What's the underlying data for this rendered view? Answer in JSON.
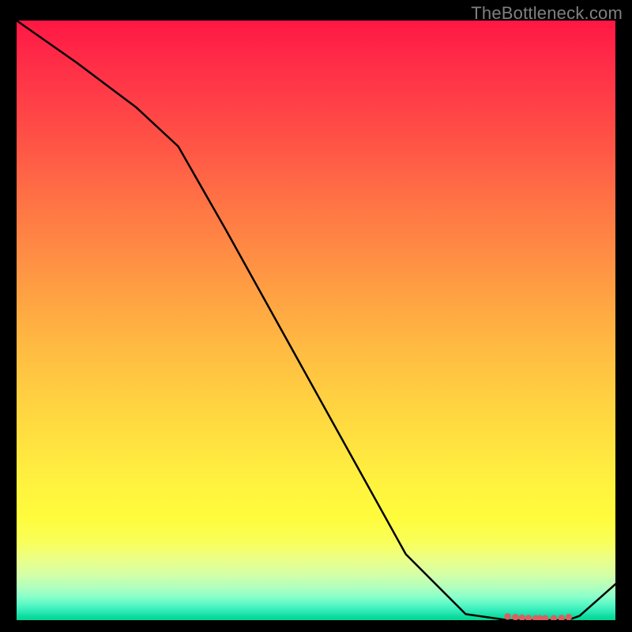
{
  "watermark": "TheBottleneck.com",
  "colors": {
    "line": "#000000",
    "scatter": "#d86060",
    "gradient_top": "#ff1744",
    "gradient_bottom": "#00d78e"
  },
  "chart_data": {
    "type": "line",
    "title": "",
    "xlabel": "",
    "ylabel": "",
    "xlim": [
      0,
      100
    ],
    "ylim": [
      0,
      100
    ],
    "series": [
      {
        "name": "curve",
        "x": [
          0,
          10,
          20,
          27,
          35,
          45,
          55,
          65,
          75,
          82,
          86,
          89,
          92,
          94,
          100
        ],
        "y": [
          100,
          93,
          85.5,
          79,
          65,
          47,
          29,
          11,
          1,
          0,
          0,
          0,
          0,
          0.7,
          6
        ]
      }
    ],
    "scatter": {
      "name": "bottom-cluster",
      "x": [
        82,
        83.3,
        84.4,
        85.5,
        86.7,
        87.4,
        88.3,
        89.7,
        91.0,
        92.2
      ],
      "y": [
        0.6,
        0.5,
        0.4,
        0.35,
        0.3,
        0.3,
        0.3,
        0.3,
        0.35,
        0.5
      ]
    }
  }
}
